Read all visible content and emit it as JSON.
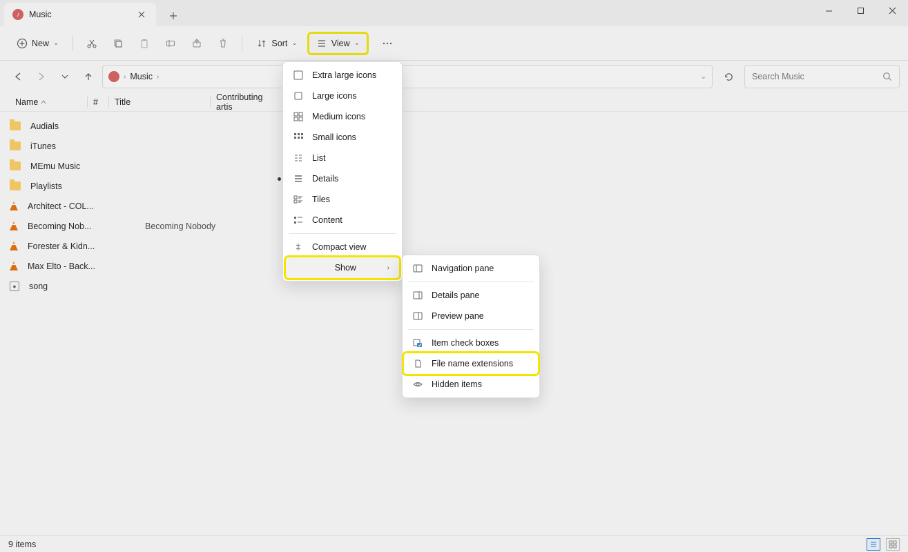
{
  "tab": {
    "title": "Music"
  },
  "toolbar": {
    "new_label": "New",
    "sort_label": "Sort",
    "view_label": "View"
  },
  "breadcrumb": {
    "root": "Music"
  },
  "search": {
    "placeholder": "Search Music"
  },
  "columns": {
    "name": "Name",
    "num": "#",
    "title": "Title",
    "artists": "Contributing artis"
  },
  "files": [
    {
      "type": "folder",
      "name": "Audials"
    },
    {
      "type": "folder",
      "name": "iTunes"
    },
    {
      "type": "folder",
      "name": "MEmu Music"
    },
    {
      "type": "folder",
      "name": "Playlists"
    },
    {
      "type": "vlc",
      "name": "Architect - COL...",
      "title": ""
    },
    {
      "type": "vlc",
      "name": "Becoming Nob...",
      "title": "Becoming Nobody"
    },
    {
      "type": "vlc",
      "name": "Forester & Kidn...",
      "title": ""
    },
    {
      "type": "vlc",
      "name": "Max Elto - Back...",
      "title": ""
    },
    {
      "type": "song",
      "name": "song",
      "title": ""
    }
  ],
  "view_menu": {
    "extra_large": "Extra large icons",
    "large": "Large icons",
    "medium": "Medium icons",
    "small": "Small icons",
    "list": "List",
    "details": "Details",
    "tiles": "Tiles",
    "content": "Content",
    "compact": "Compact view",
    "show": "Show"
  },
  "show_menu": {
    "nav_pane": "Navigation pane",
    "details_pane": "Details pane",
    "preview_pane": "Preview pane",
    "item_checkboxes": "Item check boxes",
    "file_ext": "File name extensions",
    "hidden": "Hidden items"
  },
  "status": {
    "count": "9 items"
  }
}
